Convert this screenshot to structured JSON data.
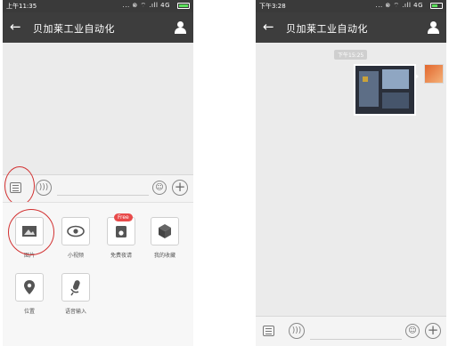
{
  "left": {
    "status": {
      "time": "上午11:35",
      "signal": "... ⊗ ⌔ .ıll 4G"
    },
    "header": {
      "back_arrow": "←",
      "title": "贝加莱工业自动化",
      "profile_icon": "person-icon"
    },
    "input_bar": {
      "voice_icon": ")))",
      "emoji_icon": "☺",
      "plus_icon": "+"
    },
    "panel_items": [
      {
        "label": "图片",
        "icon": "picture-icon"
      },
      {
        "label": "小视频",
        "icon": "eye-icon"
      },
      {
        "label": "免费夜请",
        "icon": "camera-icon",
        "badge": "Free"
      },
      {
        "label": "我的收藏",
        "icon": "box-icon"
      },
      {
        "label": "位置",
        "icon": "location-icon"
      },
      {
        "label": "语音输入",
        "icon": "microphone-icon"
      }
    ]
  },
  "right": {
    "status": {
      "time": "下午3:28",
      "signal": "... ⊗ ⌔ .ıll 4G"
    },
    "header": {
      "back_arrow": "←",
      "title": "贝加莱工业自动化",
      "profile_icon": "person-icon"
    },
    "timestamp": "下午15:25",
    "input_bar": {
      "voice_icon": ")))",
      "emoji_icon": "☺",
      "plus_icon": "+"
    }
  },
  "colors": {
    "accent_circle": "#d23030",
    "topbar": "#3d3d3d",
    "chat_bg": "#ebebeb",
    "battery": "#5ce05c"
  }
}
